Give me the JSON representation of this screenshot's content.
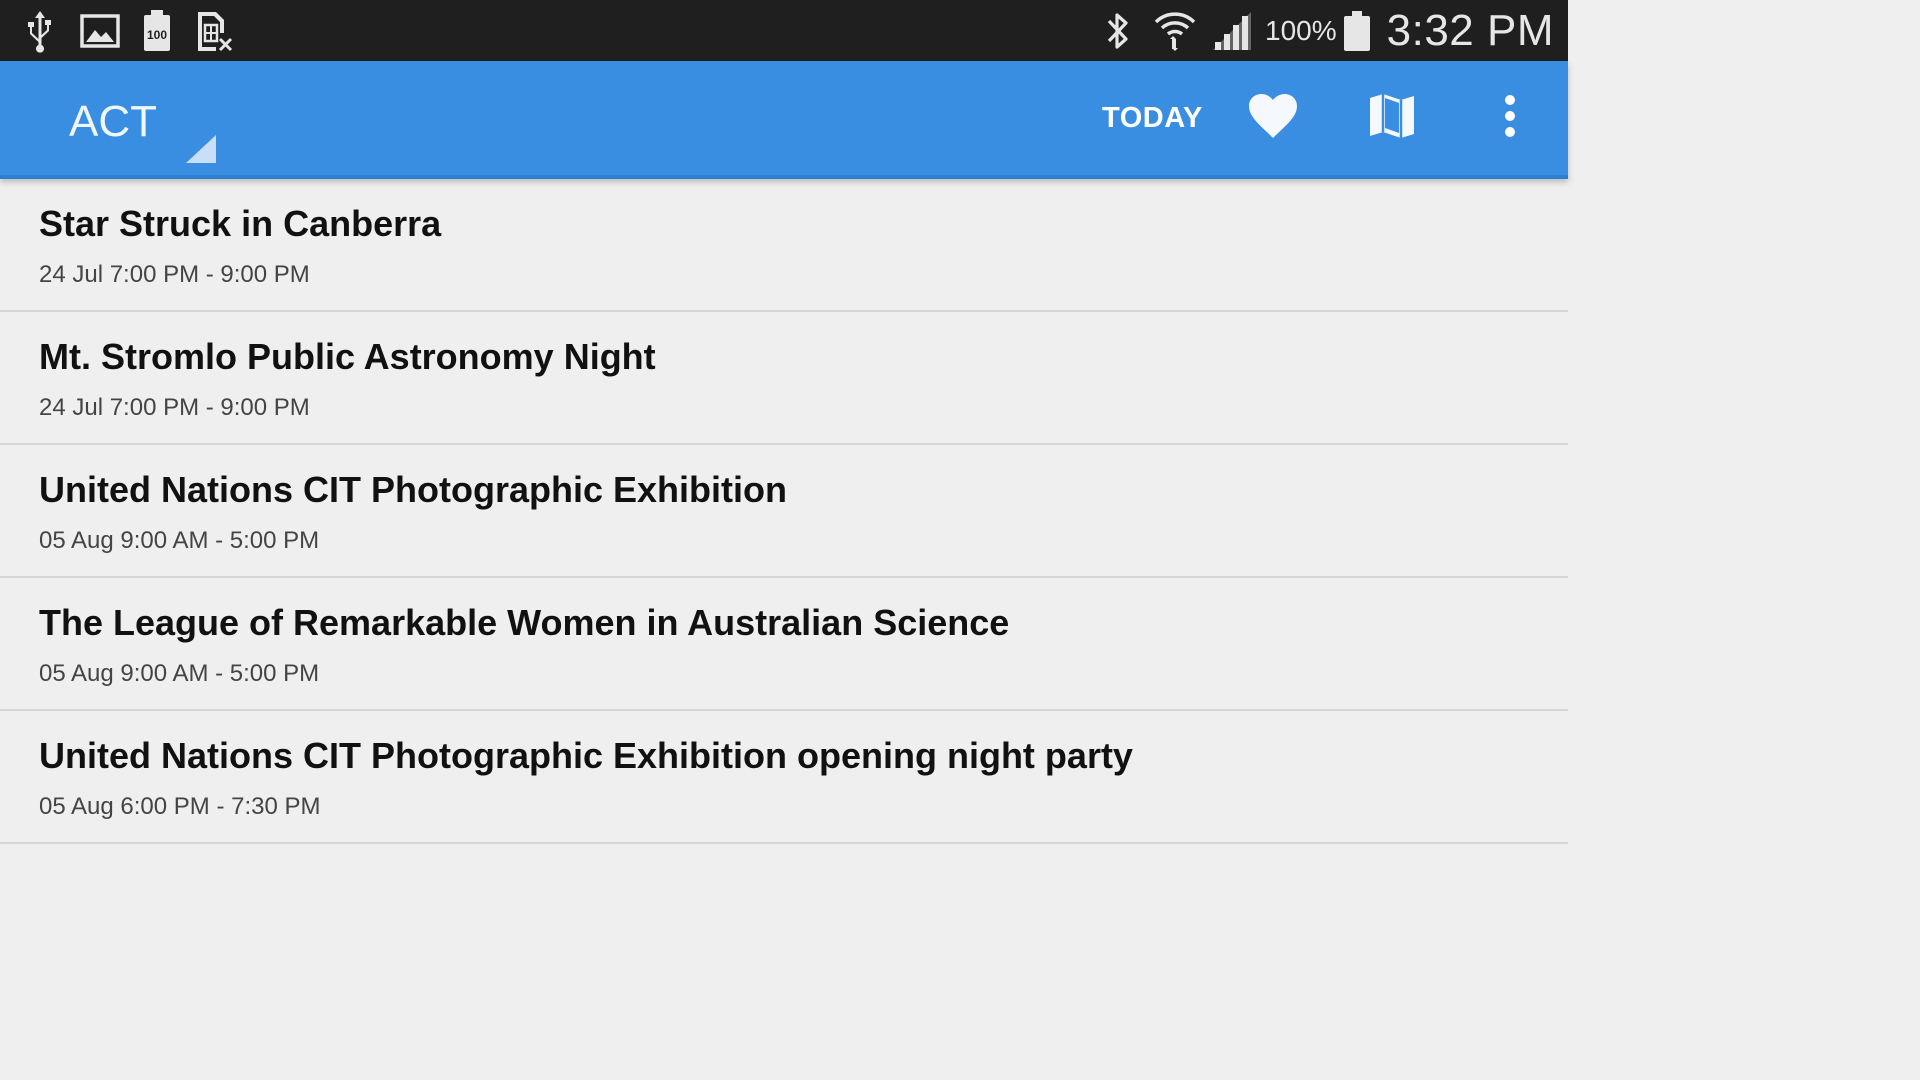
{
  "status_bar": {
    "left_icons": [
      "usb-icon",
      "image-icon",
      "battery-100-icon",
      "no-sim-icon"
    ],
    "right_icons": [
      "bluetooth-icon",
      "wifi-icon",
      "signal-icon",
      "battery-icon"
    ],
    "battery_percent": "100%",
    "time": "3:32 PM"
  },
  "app_bar": {
    "spinner_label": "ACT",
    "today_label": "TODAY",
    "icons": [
      "favorite-heart-icon",
      "map-icon",
      "overflow-menu-icon"
    ],
    "accent_color": "#3a8ee2"
  },
  "events": [
    {
      "title": "Star Struck in Canberra",
      "time": "24 Jul 7:00 PM - 9:00 PM"
    },
    {
      "title": "Mt. Stromlo Public Astronomy Night",
      "time": "24 Jul 7:00 PM - 9:00 PM"
    },
    {
      "title": "United Nations CIT Photographic Exhibition",
      "time": "05 Aug 9:00 AM - 5:00 PM"
    },
    {
      "title": "The League of Remarkable Women in Australian Science",
      "time": "05 Aug 9:00 AM - 5:00 PM"
    },
    {
      "title": "United Nations CIT Photographic Exhibition opening night party",
      "time": "05 Aug 6:00 PM - 7:30 PM"
    }
  ]
}
